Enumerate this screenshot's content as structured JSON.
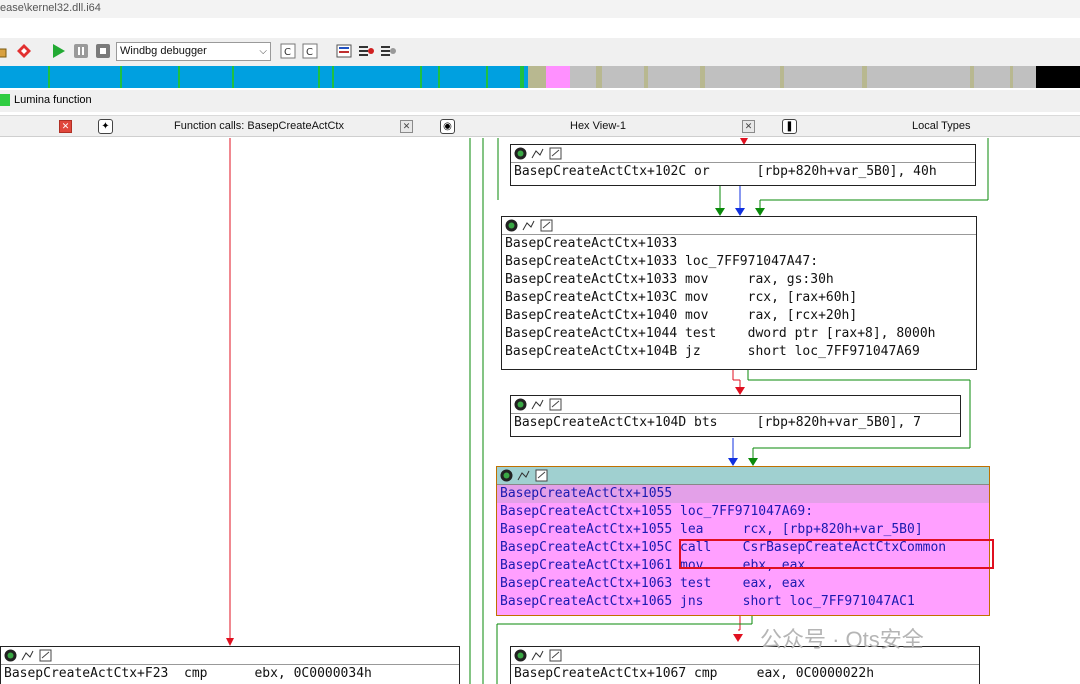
{
  "window": {
    "title_path": "ease\\kernel32.dll.i64"
  },
  "toolbar": {
    "debugger_select": "Windbg debugger"
  },
  "legend": {
    "label": "Lumina function"
  },
  "tabs": [
    {
      "title": "Function calls: BasepCreateActCtx"
    },
    {
      "title": "Hex View-1"
    },
    {
      "title": "Local Types"
    }
  ],
  "nodes": {
    "n102c": {
      "lines": [
        "BasepCreateActCtx+102C or      [rbp+820h+var_5B0], 40h"
      ]
    },
    "n1033": {
      "lines": [
        "BasepCreateActCtx+1033",
        "BasepCreateActCtx+1033 loc_7FF971047A47:",
        "BasepCreateActCtx+1033 mov     rax, gs:30h",
        "BasepCreateActCtx+103C mov     rcx, [rax+60h]",
        "BasepCreateActCtx+1040 mov     rax, [rcx+20h]",
        "BasepCreateActCtx+1044 test    dword ptr [rax+8], 8000h",
        "BasepCreateActCtx+104B jz      short loc_7FF971047A69"
      ]
    },
    "n104d": {
      "lines": [
        "BasepCreateActCtx+104D bts     [rbp+820h+var_5B0], 7"
      ]
    },
    "n1055": {
      "lines": [
        "BasepCreateActCtx+1055",
        "BasepCreateActCtx+1055 loc_7FF971047A69:",
        "BasepCreateActCtx+1055 lea     rcx, [rbp+820h+var_5B0]",
        "BasepCreateActCtx+105C call    CsrBasepCreateActCtxCommon",
        "BasepCreateActCtx+1061 mov     ebx, eax",
        "BasepCreateActCtx+1063 test    eax, eax",
        "BasepCreateActCtx+1065 jns     short loc_7FF971047AC1"
      ]
    },
    "nf23": {
      "lines": [
        "BasepCreateActCtx+F23  cmp      ebx, 0C0000034h"
      ]
    },
    "n1067": {
      "lines": [
        "BasepCreateActCtx+1067 cmp     eax, 0C0000022h"
      ]
    }
  },
  "watermark": "公众号 · Ots安全",
  "colors": {
    "selected_node": "#ff9fff",
    "highlight_box": "#e01020",
    "edge_true": "#0a8a0a",
    "edge_false": "#e01020",
    "edge_uncond": "#1030e0"
  }
}
